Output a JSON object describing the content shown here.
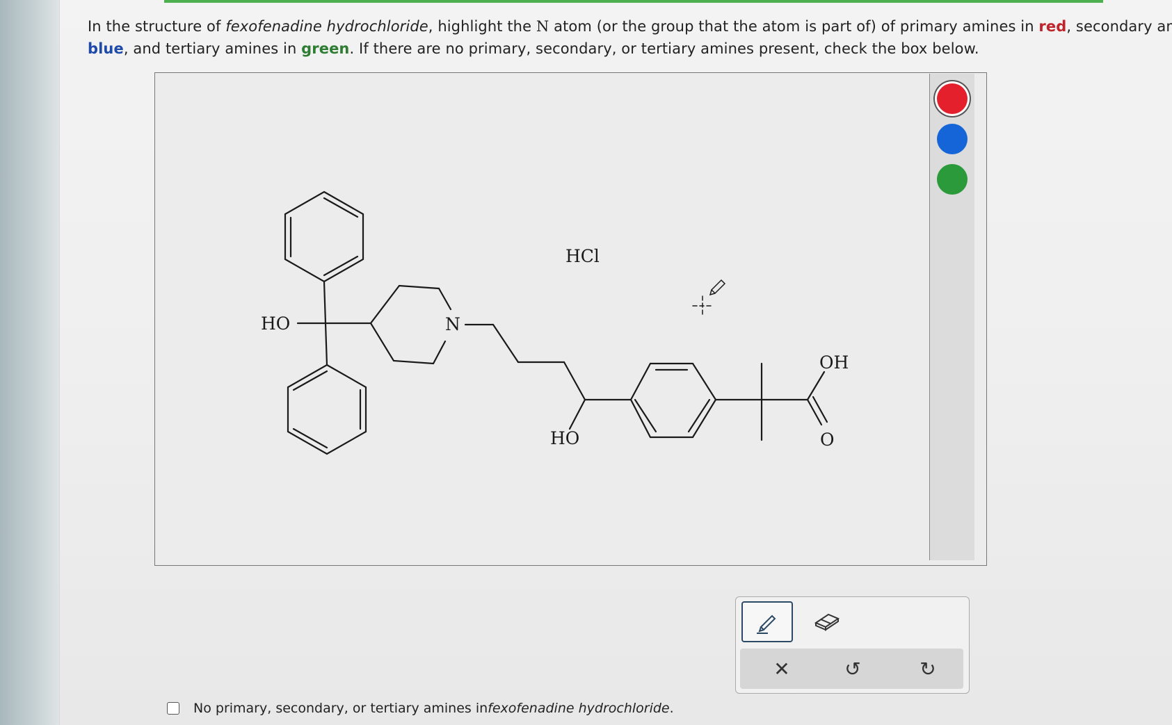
{
  "question": {
    "p1": "In the structure of ",
    "compound": "fexofenadine hydrochloride",
    "p2": ", highlight the ",
    "n_atom": "N",
    "p3": " atom (or the group that the atom is part of) of primary amines in ",
    "red_word": "red",
    "p4": ", secondary amine",
    "blue_word": "blue",
    "p5": ", and tertiary amines in ",
    "green_word": "green",
    "p6": ". If there are no primary, secondary, or tertiary amines present, check the box below."
  },
  "molecule": {
    "labels": {
      "ho_left": "HO",
      "n": "N",
      "hcl": "HCl",
      "ho_bottom": "HO",
      "oh": "OH",
      "o": "O"
    }
  },
  "palette": {
    "colors": {
      "red": "#e3202b",
      "blue": "#1565d8",
      "green": "#2b9a3a"
    },
    "selected": "red"
  },
  "tools": {
    "pencil_icon": "pencil-icon",
    "eraser_icon": "eraser-icon",
    "clear_glyph": "✕",
    "undo_glyph": "↺",
    "redo_glyph": "↻"
  },
  "checkbox": {
    "label_start": "No primary, secondary, or tertiary amines in ",
    "label_compound": "fexofenadine hydrochloride",
    "label_end": ".",
    "checked": false
  }
}
